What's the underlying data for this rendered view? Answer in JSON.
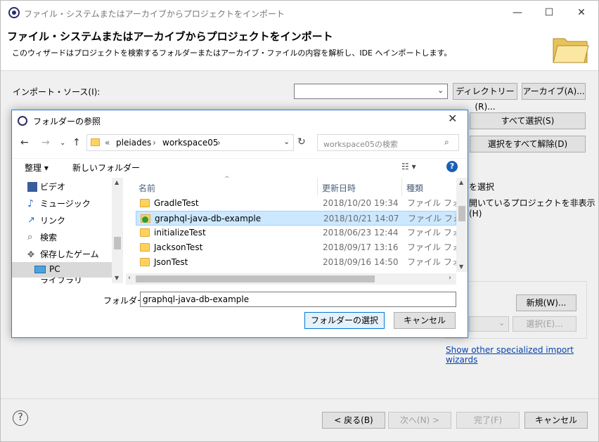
{
  "window": {
    "title": "ファイル・システムまたはアーカイブからプロジェクトをインポート",
    "minimize": "—",
    "maximize": "☐",
    "close": "✕"
  },
  "banner": {
    "title": "ファイル・システムまたはアーカイブからプロジェクトをインポート",
    "description": "このウィザードはプロジェクトを検索するフォルダーまたはアーカイブ・ファイルの内容を解析し、IDE へインポートします。"
  },
  "import_source": {
    "label": "インポート・ソース(I):",
    "value": "",
    "directory_button": "ディレクトリー(R)...",
    "archive_button": "アーカイブ(A)..."
  },
  "side_buttons": {
    "select_all": "すべて選択(S)",
    "deselect_all": "選択をすべて解除(D)"
  },
  "partial_labels": {
    "select_partial": "を選択",
    "hide_open": "開いているプロジェクトを非表示(H)"
  },
  "working_set": {
    "new_button": "新規(W)...",
    "select_button": "選択(E)..."
  },
  "link": "Show other specialized import wizards",
  "footer": {
    "back": "< 戻る(B)",
    "next": "次へ(N) >",
    "finish": "完了(F)",
    "cancel": "キャンセル"
  },
  "dialog": {
    "title": "フォルダーの参照",
    "path": [
      "«",
      "pleiades",
      "›",
      "workspace05",
      "›"
    ],
    "search_placeholder": "workspace05の検索",
    "toolbar": {
      "organize": "整理 ▾",
      "new_folder": "新しいフォルダー"
    },
    "nav_items": [
      {
        "label": "ビデオ",
        "icon": "video-icon"
      },
      {
        "label": "ミュージック",
        "icon": "music-icon"
      },
      {
        "label": "リンク",
        "icon": "link-icon"
      },
      {
        "label": "検索",
        "icon": "search-icon"
      },
      {
        "label": "保存したゲーム",
        "icon": "game-icon"
      },
      {
        "label": "PC",
        "icon": "pc-icon"
      },
      {
        "label": "ライブラリ",
        "icon": "library-icon"
      }
    ],
    "columns": {
      "name": "名前",
      "date": "更新日時",
      "type": "種類"
    },
    "rows": [
      {
        "name": "GradleTest",
        "date": "2018/10/20 19:34",
        "type": "ファイル フォルダー"
      },
      {
        "name": "graphql-java-db-example",
        "date": "2018/10/21 14:07",
        "type": "ファイル フォルダー"
      },
      {
        "name": "initializeTest",
        "date": "2018/06/23 12:44",
        "type": "ファイル フォルダー"
      },
      {
        "name": "JacksonTest",
        "date": "2018/09/17 13:16",
        "type": "ファイル フォルダー"
      },
      {
        "name": "JsonTest",
        "date": "2018/09/16 14:50",
        "type": "ファイル フォルダー"
      }
    ],
    "folder_label": "フォルダー:",
    "folder_value": "graphql-java-db-example",
    "select_button": "フォルダーの選択",
    "cancel_button": "キャンセル"
  }
}
